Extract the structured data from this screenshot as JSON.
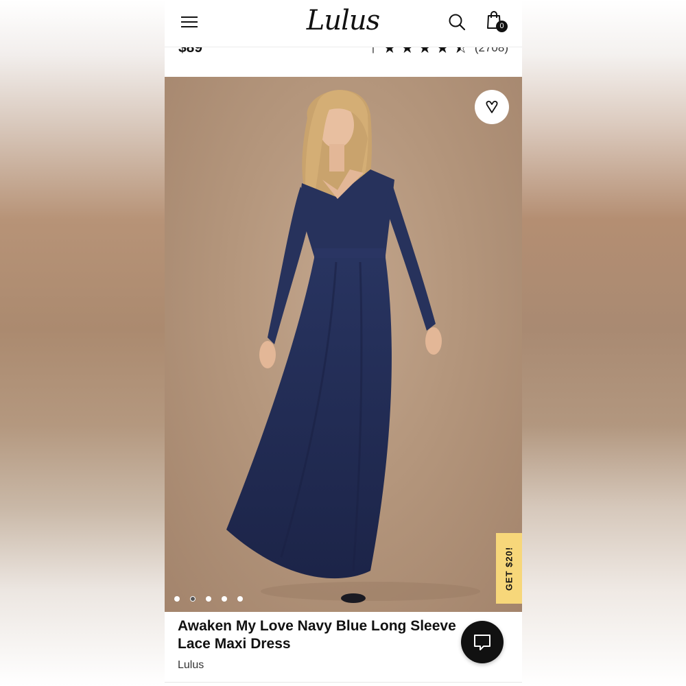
{
  "header": {
    "logo_text": "Lulus",
    "cart_count": "0"
  },
  "product": {
    "price": "$89",
    "rating_value": 4.5,
    "rating_count": "(2708)",
    "title": "Awaken My Love Navy Blue Long Sleeve Lace Maxi Dress",
    "brand": "Lulus"
  },
  "promo": {
    "label": "GET $20!",
    "color": "#f7d77a"
  },
  "gallery": {
    "image_count": 5,
    "active_index": 1
  },
  "colors": {
    "dress": "#1f2a4f",
    "backdrop": "#b4967c"
  }
}
